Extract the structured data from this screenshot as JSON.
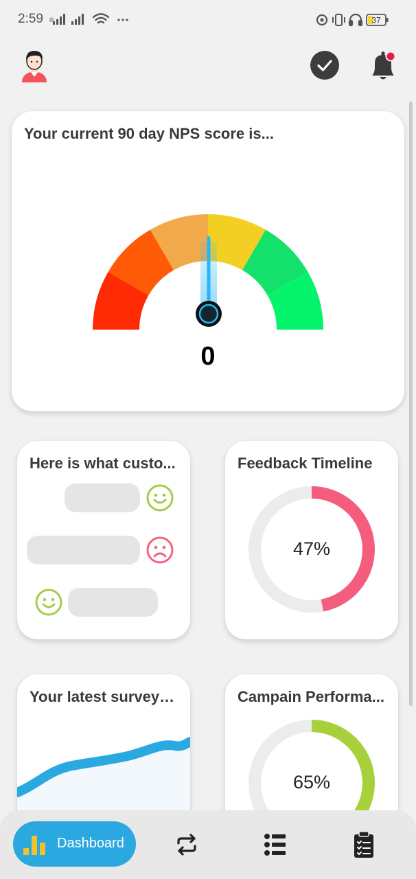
{
  "status_bar": {
    "time": "2:59",
    "battery": "37",
    "icons": [
      "signal-icon",
      "signal-icon",
      "wifi-icon",
      "more-dots-icon",
      "data-saver-icon",
      "vibrate-icon",
      "headphones-icon",
      "battery-icon"
    ]
  },
  "header": {
    "avatar_icon": "avatar",
    "check_icon": "check-circle-icon",
    "bell_icon": "bell-icon",
    "notification_color": "#e6194b"
  },
  "nps_card": {
    "title": "Your current 90 day NPS score is...",
    "score": "0",
    "gauge_colors": [
      "#ff2b05",
      "#ff5a06",
      "#f2a94a",
      "#f3cf23",
      "#14e16b",
      "#05f46b"
    ],
    "needle_color": "#29b6f6"
  },
  "customers_card": {
    "title": "Here is what custo...",
    "faces": [
      {
        "type": "happy",
        "color": "#a3cc4a"
      },
      {
        "type": "sad",
        "color": "#f0647c"
      },
      {
        "type": "happy",
        "color": "#a3cc4a"
      }
    ]
  },
  "feedback_card": {
    "title": "Feedback Timeline",
    "percent_label": "47%",
    "fraction": 0.47,
    "color": "#f45d7e"
  },
  "surveys_card": {
    "title": "Your latest surveys...",
    "line_color": "#2aa9e0"
  },
  "campaign_card": {
    "title": "Campain Performa...",
    "percent_label": "65%",
    "fraction": 0.65,
    "color": "#a8d03a"
  },
  "bottom_nav": {
    "dashboard_label": "Dashboard",
    "items": [
      "dashboard-icon",
      "sync-icon",
      "checklist-icon",
      "clipboard-icon"
    ]
  },
  "colors": {
    "accent": "#2ba8e0",
    "background": "#f1f1f1",
    "card": "#ffffff"
  }
}
